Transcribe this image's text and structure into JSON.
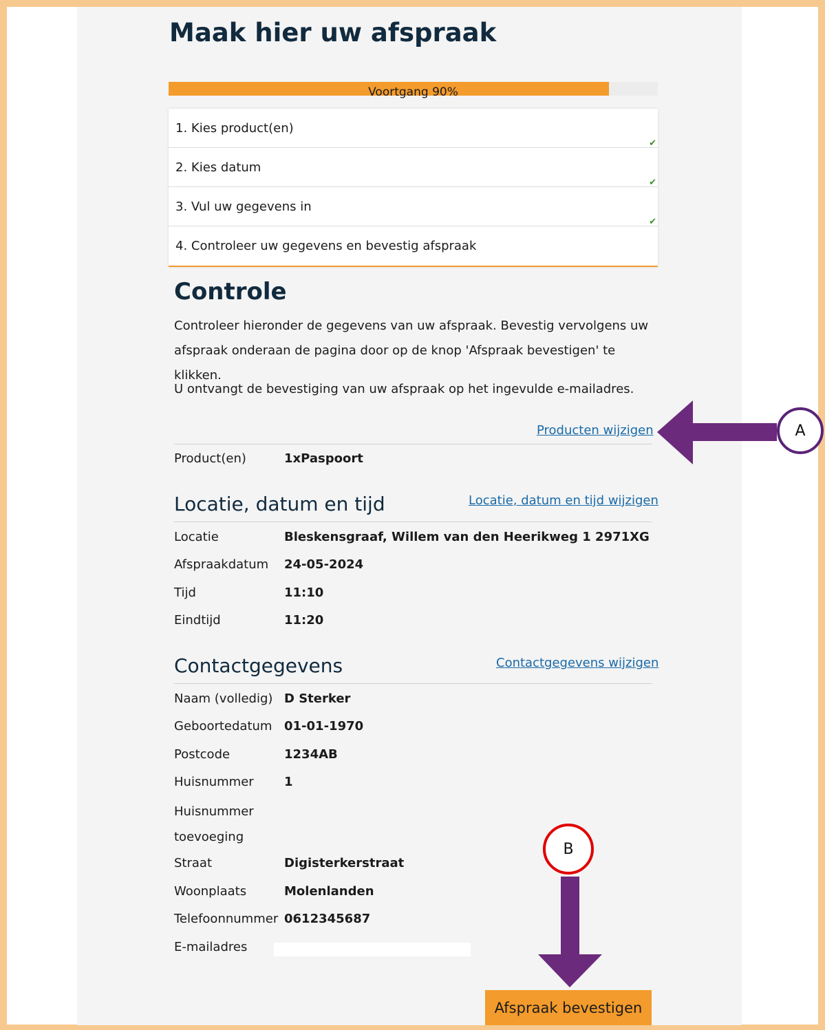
{
  "page": {
    "title": "Maak hier uw afspraak"
  },
  "progress": {
    "label": "Voortgang 90%",
    "value": 0.9,
    "fill_color": "#f39b2c"
  },
  "steps": [
    {
      "label": "1. Kies product(en)",
      "done": true
    },
    {
      "label": "2. Kies datum",
      "done": true
    },
    {
      "label": "3. Vul uw gegevens in",
      "done": true
    },
    {
      "label": "4. Controleer uw gegevens en bevestig afspraak",
      "done": false
    }
  ],
  "check_icon": "✔",
  "controle": {
    "heading": "Controle",
    "intro": "Controleer hieronder de gegevens van uw afspraak. Bevestig vervolgens uw afspraak onderaan de pagina door op de knop 'Afspraak bevestigen' te klikken.",
    "notice": "U ontvangt de bevestiging van uw afspraak op het ingevulde e-mailadres."
  },
  "products": {
    "edit_link": "Producten wijzigen",
    "label": "Product(en)",
    "value": "1xPaspoort"
  },
  "location": {
    "heading": "Locatie, datum en tijd",
    "edit_link": "Locatie, datum en tijd wijzigen",
    "rows": [
      {
        "label": "Locatie",
        "value": "Bleskensgraaf, Willem van den Heerikweg 1 2971XG"
      },
      {
        "label": "Afspraakdatum",
        "value": "24-05-2024"
      },
      {
        "label": "Tijd",
        "value": "11:10"
      },
      {
        "label": "Eindtijd",
        "value": "11:20"
      }
    ]
  },
  "contact": {
    "heading": "Contactgegevens",
    "edit_link": "Contactgegevens wijzigen",
    "rows": [
      {
        "label": "Naam (volledig)",
        "value": "D Sterker"
      },
      {
        "label": "Geboortedatum",
        "value": "01-01-1970"
      },
      {
        "label": "Postcode",
        "value": "1234AB"
      },
      {
        "label": "Huisnummer",
        "value": "1"
      }
    ],
    "addition_label_line1": "Huisnummer",
    "addition_label_line2": "toevoeging",
    "rows2": [
      {
        "label": "Straat",
        "value": "Digisterkerstraat"
      },
      {
        "label": "Woonplaats",
        "value": "Molenlanden"
      },
      {
        "label": "Telefoonnummer",
        "value": "0612345687"
      }
    ],
    "email_label": "E-mailadres"
  },
  "confirm_button": "Afspraak bevestigen",
  "annotations": {
    "marker_a": "A",
    "marker_b": "B",
    "arrow_color": "#6b2a7c"
  }
}
